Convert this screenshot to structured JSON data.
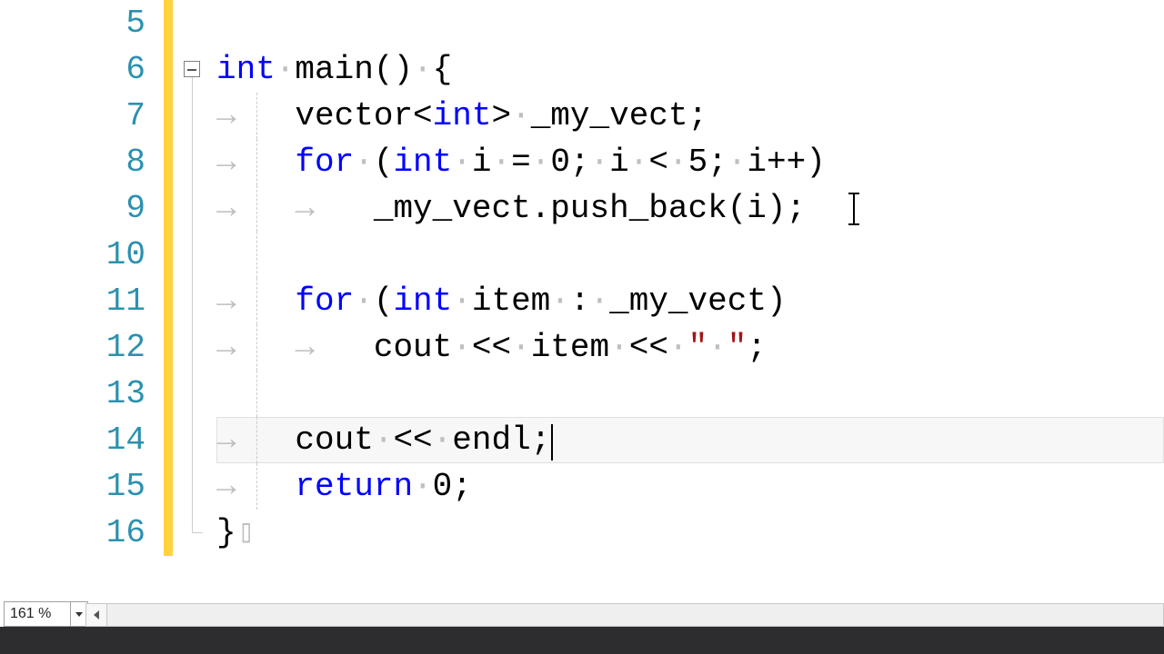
{
  "editor": {
    "zoom": "161 %",
    "lines": [
      {
        "n": 5,
        "indent": 0,
        "tokens": []
      },
      {
        "n": 6,
        "indent": 0,
        "fold": "start",
        "tokens": [
          {
            "t": "kw",
            "v": "int"
          },
          {
            "t": "dot",
            "v": "·"
          },
          {
            "t": "plain",
            "v": "main()"
          },
          {
            "t": "dot",
            "v": "·"
          },
          {
            "t": "plain",
            "v": "{"
          }
        ]
      },
      {
        "n": 7,
        "indent": 1,
        "tokens": [
          {
            "t": "plain",
            "v": "vector<"
          },
          {
            "t": "kw",
            "v": "int"
          },
          {
            "t": "plain",
            "v": ">"
          },
          {
            "t": "dot",
            "v": "·"
          },
          {
            "t": "plain",
            "v": "_my_vect;"
          }
        ]
      },
      {
        "n": 8,
        "indent": 1,
        "tokens": [
          {
            "t": "kw",
            "v": "for"
          },
          {
            "t": "dot",
            "v": "·"
          },
          {
            "t": "plain",
            "v": "("
          },
          {
            "t": "kw",
            "v": "int"
          },
          {
            "t": "dot",
            "v": "·"
          },
          {
            "t": "plain",
            "v": "i"
          },
          {
            "t": "dot",
            "v": "·"
          },
          {
            "t": "plain",
            "v": "="
          },
          {
            "t": "dot",
            "v": "·"
          },
          {
            "t": "plain",
            "v": "0;"
          },
          {
            "t": "dot",
            "v": "·"
          },
          {
            "t": "plain",
            "v": "i"
          },
          {
            "t": "dot",
            "v": "·"
          },
          {
            "t": "plain",
            "v": "<"
          },
          {
            "t": "dot",
            "v": "·"
          },
          {
            "t": "plain",
            "v": "5;"
          },
          {
            "t": "dot",
            "v": "·"
          },
          {
            "t": "plain",
            "v": "i++)"
          }
        ]
      },
      {
        "n": 9,
        "indent": 2,
        "tokens": [
          {
            "t": "plain",
            "v": "_my_vect.push_back(i);"
          }
        ],
        "mouseCaretX": 700
      },
      {
        "n": 10,
        "indent": 0,
        "tokens": []
      },
      {
        "n": 11,
        "indent": 1,
        "tokens": [
          {
            "t": "kw",
            "v": "for"
          },
          {
            "t": "dot",
            "v": "·"
          },
          {
            "t": "plain",
            "v": "("
          },
          {
            "t": "kw",
            "v": "int"
          },
          {
            "t": "dot",
            "v": "·"
          },
          {
            "t": "plain",
            "v": "item"
          },
          {
            "t": "dot",
            "v": "·"
          },
          {
            "t": "plain",
            "v": ":"
          },
          {
            "t": "dot",
            "v": "·"
          },
          {
            "t": "plain",
            "v": "_my_vect)"
          }
        ]
      },
      {
        "n": 12,
        "indent": 2,
        "tokens": [
          {
            "t": "plain",
            "v": "cout"
          },
          {
            "t": "dot",
            "v": "·"
          },
          {
            "t": "plain",
            "v": "<<"
          },
          {
            "t": "dot",
            "v": "·"
          },
          {
            "t": "plain",
            "v": "item"
          },
          {
            "t": "dot",
            "v": "·"
          },
          {
            "t": "plain",
            "v": "<<"
          },
          {
            "t": "dot",
            "v": "·"
          },
          {
            "t": "str",
            "v": "\""
          },
          {
            "t": "dot",
            "v": "·"
          },
          {
            "t": "str",
            "v": "\""
          },
          {
            "t": "plain",
            "v": ";"
          }
        ]
      },
      {
        "n": 13,
        "indent": 0,
        "tokens": []
      },
      {
        "n": 14,
        "indent": 1,
        "current": true,
        "tokens": [
          {
            "t": "plain",
            "v": "cout"
          },
          {
            "t": "dot",
            "v": "·"
          },
          {
            "t": "plain",
            "v": "<<"
          },
          {
            "t": "dot",
            "v": "·"
          },
          {
            "t": "plain",
            "v": "endl;"
          }
        ],
        "caret": true
      },
      {
        "n": 15,
        "indent": 1,
        "tokens": [
          {
            "t": "kw",
            "v": "return"
          },
          {
            "t": "dot",
            "v": "·"
          },
          {
            "t": "plain",
            "v": "0;"
          }
        ]
      },
      {
        "n": 16,
        "indent": 0,
        "fold": "end",
        "tokens": [
          {
            "t": "plain",
            "v": "}"
          },
          {
            "t": "para",
            "v": ""
          }
        ]
      }
    ]
  },
  "glyphs": {
    "tab": "→",
    "space": "·",
    "para": "▯"
  }
}
